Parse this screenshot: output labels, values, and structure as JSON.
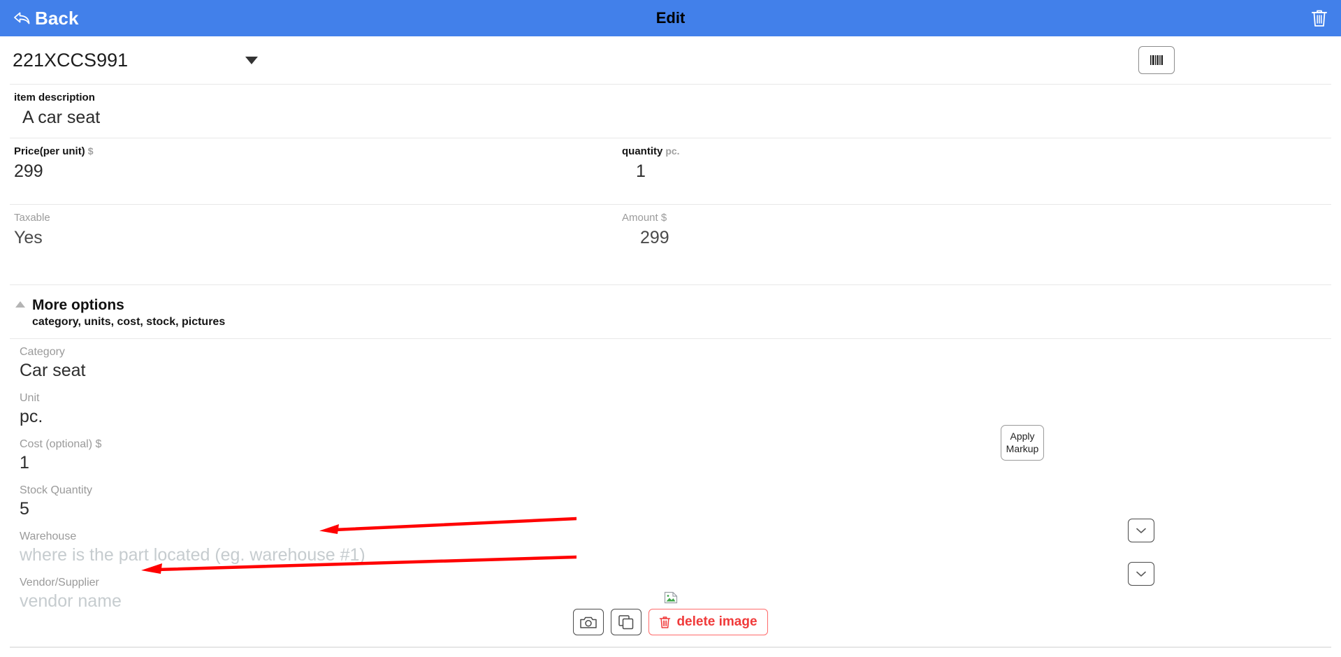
{
  "header": {
    "back_label": "Back",
    "back_icon": "undo-arrow-icon",
    "title": "Edit",
    "delete_icon": "trash-icon",
    "background_color": "#4280ea"
  },
  "sku": {
    "value": "221XCCS991",
    "caret_icon": "caret-down-icon",
    "barcode_icon": "barcode-icon"
  },
  "fields": {
    "item_description": {
      "label": "item description",
      "value": "A car seat"
    },
    "price": {
      "label": "Price(per unit)",
      "unit": "$",
      "value": "299"
    },
    "quantity": {
      "label": "quantity",
      "unit": "pc.",
      "value": "1"
    },
    "taxable": {
      "label": "Taxable",
      "value": "Yes"
    },
    "amount": {
      "label": "Amount $",
      "value": "299"
    }
  },
  "more_options": {
    "caret_icon": "caret-up-icon",
    "title": "More options",
    "subtitle": "category, units, cost, stock, pictures"
  },
  "options": {
    "category": {
      "label": "Category",
      "value": "Car seat"
    },
    "unit": {
      "label": "Unit",
      "value": "pc."
    },
    "cost": {
      "label": "Cost (optional) $",
      "value": "1"
    },
    "stock_quantity": {
      "label": "Stock Quantity",
      "value": "5"
    },
    "warehouse": {
      "label": "Warehouse",
      "placeholder": "where is the part located (eg. warehouse #1)"
    },
    "vendor": {
      "label": "Vendor/Supplier",
      "placeholder": "vendor name"
    }
  },
  "buttons": {
    "apply_markup_line1": "Apply",
    "apply_markup_line2": "Markup",
    "warehouse_dropdown_icon": "chevron-down-icon",
    "vendor_dropdown_icon": "chevron-down-icon",
    "camera_icon": "camera-icon",
    "gallery_icon": "copy-images-icon",
    "delete_image_label": "delete image",
    "delete_image_icon": "trash-icon"
  },
  "image_placeholder": {
    "icon": "broken-image-icon"
  },
  "annotations": {
    "arrow_color": "#ff0000",
    "arrow_1_target": "warehouse-field",
    "arrow_2_target": "vendor-field"
  }
}
